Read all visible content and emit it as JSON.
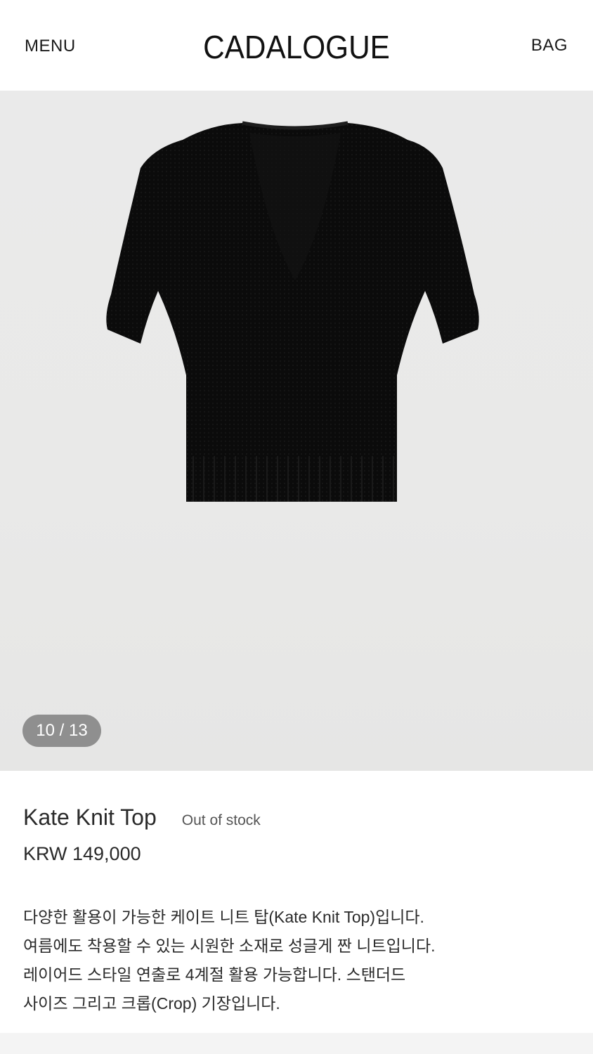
{
  "header": {
    "menu_label": "MENU",
    "logo_text": "CADALOGUE",
    "bag_label": "BAG"
  },
  "gallery": {
    "counter": "10 / 13",
    "background_color": "#eaeaea",
    "product_color": "#0b0b0b"
  },
  "product": {
    "name": "Kate Knit Top",
    "stock_status": "Out of stock",
    "price": "KRW 149,000",
    "description_lines": [
      "다양한 활용이 가능한 케이트 니트 탑(Kate Knit Top)입니다.",
      "여름에도 착용할 수 있는 시원한 소재로 성글게 짠 니트입니다.",
      "레이어드 스타일 연출로 4계절 활용 가능합니다. 스탠더드",
      "사이즈 그리고 크롭(Crop) 기장입니다."
    ]
  }
}
